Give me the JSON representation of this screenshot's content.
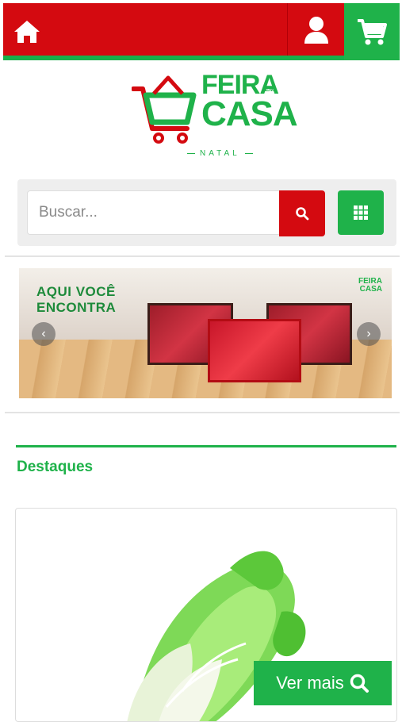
{
  "header": {
    "icons": {
      "home": "home-icon",
      "user": "user-icon",
      "cart": "cart-icon"
    },
    "colors": {
      "red": "#d40a10",
      "green": "#1fb24a"
    }
  },
  "logo": {
    "line1": "FEIRA",
    "small": "EM",
    "line2": "CASA",
    "city": "NATAL"
  },
  "search": {
    "placeholder": "Buscar...",
    "value": ""
  },
  "banner": {
    "headline_line1": "AQUI VOCÊ",
    "headline_line2": "ENCONTRA",
    "mini_logo_line1": "FEIRA",
    "mini_logo_line2": "CASA"
  },
  "featured": {
    "title": "Destaques"
  },
  "product": {
    "button_label": "Ver mais"
  }
}
